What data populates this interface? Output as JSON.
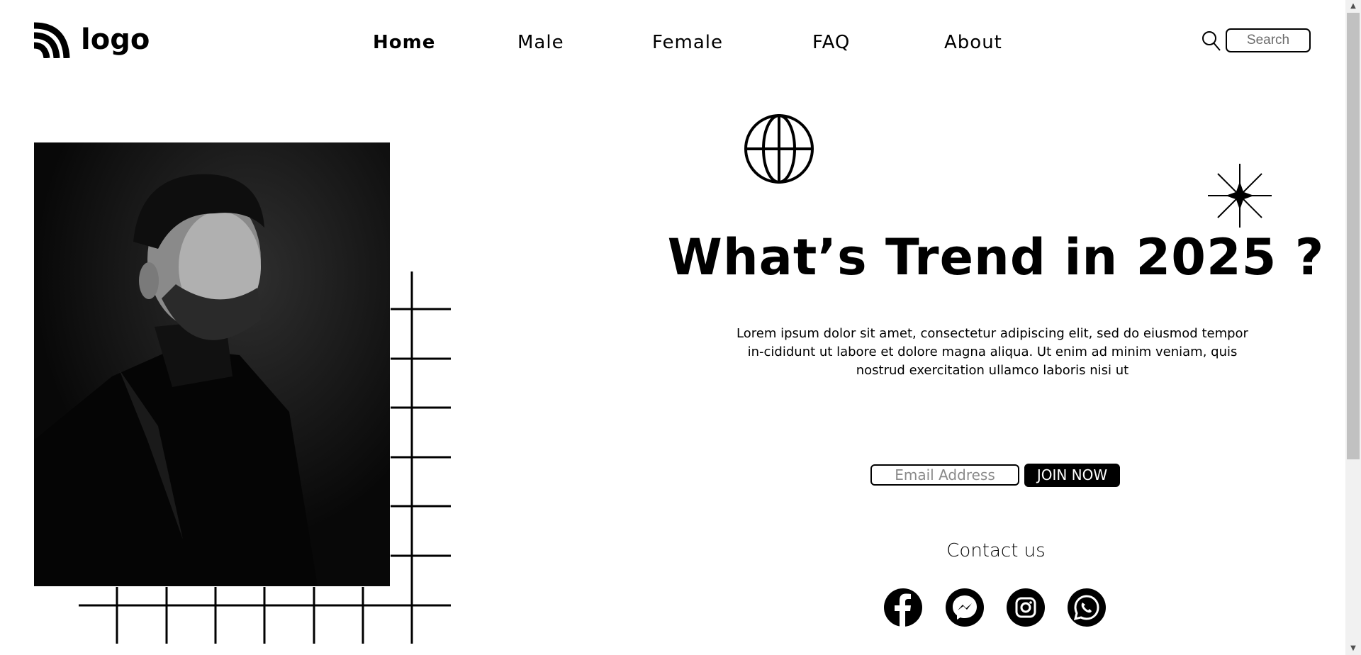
{
  "header": {
    "logo_text": "logo",
    "nav": [
      "Home",
      "Male",
      "Female",
      "FAQ",
      "About"
    ],
    "active_nav": "Home",
    "search_placeholder": "Search"
  },
  "hero": {
    "headline": "What’s Trend in 2025 ?",
    "paragraph": "Lorem ipsum dolor sit amet, consectetur adipiscing elit, sed do eiusmod tempor in-cididunt ut labore et dolore magna aliqua. Ut enim ad minim veniam, quis nostrud exercitation ullamco laboris nisi ut",
    "email_placeholder": "Email Address",
    "join_label": "JOIN NOW"
  },
  "contact": {
    "title": "Contact us",
    "icons": [
      "facebook-icon",
      "messenger-icon",
      "instagram-icon",
      "whatsapp-icon"
    ]
  },
  "colors": {
    "background": "#ffffff",
    "foreground": "#000000",
    "button_bg": "#000000",
    "button_text": "#ffffff"
  }
}
